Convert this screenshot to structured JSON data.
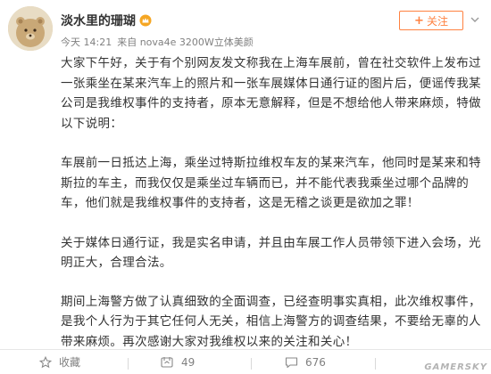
{
  "user": {
    "name": "淡水里的珊瑚",
    "time": "今天 14:21",
    "source": "来自 nova4e 3200W立体美颜"
  },
  "follow": {
    "label": "关注"
  },
  "post": {
    "paragraphs": [
      "大家下午好，关于有个别网友发文称我在上海车展前，曾在社交软件上发布过一张乘坐在某来汽车上的照片和一张车展媒体日通行证的图片后，便谣传我某公司是我维权事件的支持者，原本无意解释，但是不想给他人带来麻烦，特做以下说明：",
      "车展前一日抵达上海，乘坐过特斯拉维权车友的某来汽车，他同时是某来和特斯拉的车主，而我仅仅是乘坐过车辆而已，并不能代表我乘坐过哪个品牌的车，他们就是我维权事件的支持者，这是无稽之谈更是欲加之罪！",
      "关于媒体日通行证，我是实名申请，并且由车展工作人员带领下进入会场，光明正大，合理合法。",
      "期间上海警方做了认真细致的全面调查，已经查明事实真相，此次维权事件，是我个人行为于其它任何人无关，相信上海警方的调查结果，不要给无辜的人带来麻烦。再次感谢大家对我维权以来的关注和关心！"
    ]
  },
  "footer": {
    "favorite_label": "收藏",
    "repost_count": "49",
    "comment_count": "676"
  },
  "watermark": "GAMERSKY",
  "colors": {
    "accent": "#ff8140",
    "text": "#333333",
    "muted": "#808080"
  }
}
